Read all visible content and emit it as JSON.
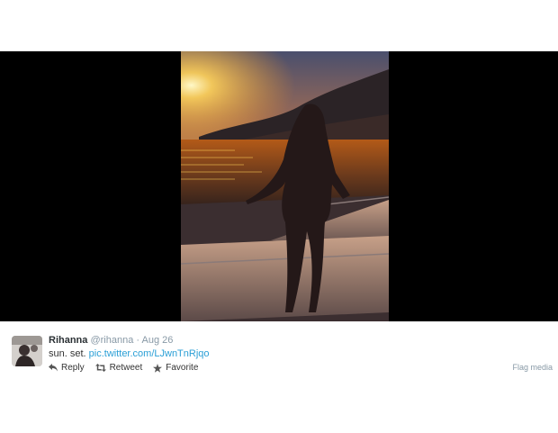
{
  "media": {
    "alt": "Woman standing on a boat deck silhouetted against a sunset over a bay"
  },
  "tweet": {
    "author_name": "Rihanna",
    "handle": "@rihanna",
    "separator": "·",
    "date": "Aug 26",
    "text": "sun. set.",
    "link": "pic.twitter.com/LJwnTnRjqo",
    "actions": {
      "reply": "Reply",
      "retweet": "Retweet",
      "favorite": "Favorite"
    },
    "flag": "Flag media"
  },
  "colors": {
    "background": "#ffffff",
    "media_background": "#000000",
    "link": "#2a9fd6",
    "muted": "#8899a6"
  },
  "icons": [
    "reply-icon",
    "retweet-icon",
    "star-icon"
  ]
}
